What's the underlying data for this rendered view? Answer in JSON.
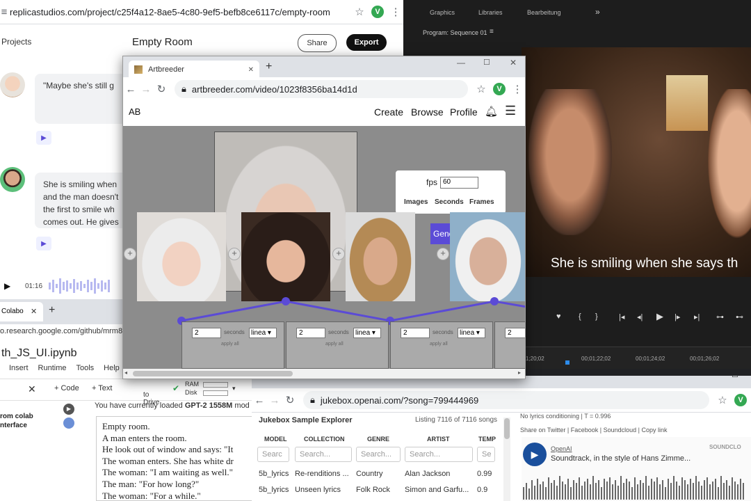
{
  "replica": {
    "url": "replicastudios.com/project/c25f4a12-8ae5-4c80-9ef5-befb8ce6117c/empty-room",
    "nav_projects": "Projects",
    "title": "Empty Room",
    "share_label": "Share",
    "export_label": "Export",
    "msg1": "\"Maybe she's still g",
    "msg2": "She is smiling when and the man doesn't the first to smile wh comes out. He gives",
    "time": "01:16"
  },
  "premiere": {
    "tab_graphics": "Graphics",
    "tab_libraries": "Libraries",
    "tab_editing": "Bearbeitung",
    "panel_title": "Program: Sequence 01",
    "subtitle": "She is smiling when she says th",
    "timecodes": [
      "1;20;02",
      "00;01;22;02",
      "00;01;24;02",
      "00;01;26;02"
    ]
  },
  "colab": {
    "tab": "Colabo",
    "url": "o.research.google.com/github/mrm8",
    "notebook": "th_JS_UI.ipynb",
    "menu": [
      "Insert",
      "Runtime",
      "Tools",
      "Help"
    ],
    "add_code": "+ Code",
    "add_text": "+ Text",
    "drive": "to Drive",
    "ram": "RAM",
    "disk": "Disk",
    "left_panel": "rom colab nterface",
    "loaded_prefix": "You have currently loaded ",
    "loaded_model": "GPT-2 1558M",
    "loaded_suffix": " mod",
    "poem": [
      "Empty room.",
      "A man enters the room.",
      "He look out of window and says: \"It",
      "The woman enters. She has white dr",
      "The woman: \"I am waiting as well.\"",
      "The man: \"For how long?\"",
      "The woman: \"For a while.\""
    ]
  },
  "jukebox": {
    "url": "jukebox.openai.com/?song=799444969",
    "title": "Jukebox Sample Explorer",
    "listing": "Listing 7116 of 7116 songs",
    "headers": [
      "MODEL",
      "COLLECTION",
      "GENRE",
      "ARTIST",
      "TEMP"
    ],
    "placeholders": [
      "Searc",
      "Search...",
      "Search...",
      "Search...",
      "Se"
    ],
    "rows": [
      [
        "5b_lyrics",
        "Re-renditions ...",
        "Country",
        "Alan Jackson",
        "0.99"
      ],
      [
        "5b_lyrics",
        "Unseen lyrics",
        "Folk Rock",
        "Simon and Garfu...",
        "0.9"
      ]
    ],
    "info": "No lyrics conditioning | T = 0.996",
    "share": "Share on Twitter | Facebook | Soundcloud | Copy link",
    "artist": "OpenAI",
    "track": "Soundtrack, in the style of Hans Zimme...",
    "soundcloud": "SOUNDCLO"
  },
  "artbreeder": {
    "tab": "Artbreeder",
    "url": "artbreeder.com/video/1023f8356ba14d1d",
    "logo": "AB",
    "nav": [
      "Create",
      "Browse",
      "Profile"
    ],
    "fps_label": "fps",
    "fps_value": "60",
    "stats": [
      "Images",
      "Seconds",
      "Frames"
    ],
    "generate": "Gene",
    "segments": [
      {
        "seconds": "2",
        "label": "seconds",
        "interp": "linea",
        "apply": "apply all"
      },
      {
        "seconds": "2",
        "label": "seconds",
        "interp": "linea",
        "apply": "apply all"
      },
      {
        "seconds": "2",
        "label": "seconds",
        "interp": "linea",
        "apply": "apply all"
      },
      {
        "seconds": "2",
        "label": "",
        "interp": "",
        "apply": ""
      }
    ]
  },
  "colors": {
    "accent_purple": "#5b4bd6",
    "colab_green": "#34a853",
    "premiere_bg": "#1d1d1d"
  }
}
